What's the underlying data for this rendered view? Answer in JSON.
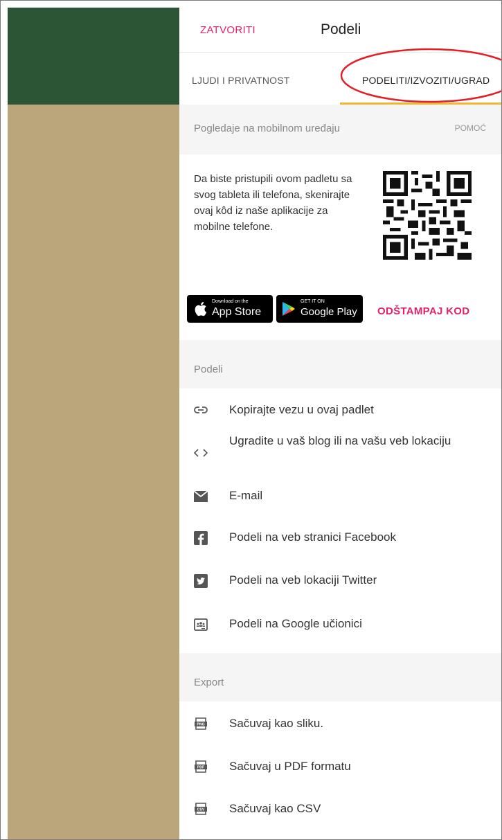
{
  "panel": {
    "close_label": "ZATVORITI",
    "title": "Podeli"
  },
  "tabs": [
    {
      "label": "LJUDI I PRIVATNOST",
      "active": false
    },
    {
      "label": "PODELITI/IZVOZITI/UGRAD",
      "active": true
    }
  ],
  "colors": {
    "accent": "#e0226f",
    "tab_underline": "#f2b632",
    "annotation": "#e31e24",
    "bg_green": "#2c5535",
    "bg_tan": "#bba67b"
  },
  "mobile": {
    "heading": "Pogledaje na mobilnom uređaju",
    "help_label": "POMOĆ",
    "description": "Da biste pristupili ovom padletu sa svog tableta ili telefona, skenirajte ovaj kôd iz naše aplikacije za mobilne telefone.",
    "appstore_small": "Download on the",
    "appstore_big": "App Store",
    "googleplay_small": "GET IT ON",
    "googleplay_big": "Google Play",
    "print_code_label": "ODŠTAMPAJ KOD"
  },
  "share": {
    "heading": "Podeli",
    "items": [
      {
        "icon": "link-icon",
        "label": "Kopirajte vezu u ovaj padlet"
      },
      {
        "icon": "code-icon",
        "label": "Ugradite u vaš blog ili na vašu veb lokaciju"
      },
      {
        "icon": "mail-icon",
        "label": "E-mail"
      },
      {
        "icon": "facebook-icon",
        "label": "Podeli na veb stranici Facebook"
      },
      {
        "icon": "twitter-icon",
        "label": "Podeli na veb lokaciji Twitter"
      },
      {
        "icon": "google-classroom-icon",
        "label": "Podeli na Google učionici"
      }
    ]
  },
  "export": {
    "heading": "Export",
    "items": [
      {
        "icon": "png-file-icon",
        "badge": "PNG",
        "label": "Sačuvaj kao sliku."
      },
      {
        "icon": "pdf-file-icon",
        "badge": "PDF",
        "label": "Sačuvaj u PDF formatu"
      },
      {
        "icon": "csv-file-icon",
        "badge": "CSV",
        "label": "Sačuvaj kao CSV"
      }
    ]
  }
}
